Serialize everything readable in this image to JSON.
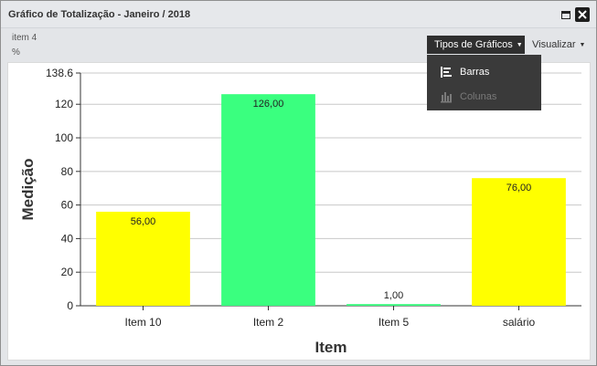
{
  "window": {
    "title": "Gráfico de Totalização - Janeiro / 2018"
  },
  "toolbar": {
    "left_line1": "item 4",
    "left_line2": "%",
    "chart_types_label": "Tipos de Gráficos",
    "view_label": "Visualizar"
  },
  "dropdown": {
    "items": [
      {
        "label": "Barras",
        "icon": "bars-icon",
        "enabled": true
      },
      {
        "label": "Colunas",
        "icon": "columns-icon",
        "enabled": false
      }
    ]
  },
  "colors": {
    "yellow": "#ffff00",
    "green": "#3aff7f",
    "grid": "#c8c8c8"
  },
  "chart_data": {
    "type": "bar",
    "categories": [
      "Item 10",
      "Item 2",
      "Item 5",
      "salário"
    ],
    "values": [
      56,
      126,
      1,
      76
    ],
    "data_labels": [
      "56,00",
      "126,00",
      "1,00",
      "76,00"
    ],
    "bar_colors": [
      "#ffff00",
      "#3aff7f",
      "#3aff7f",
      "#ffff00"
    ],
    "xlabel": "Item",
    "ylabel": "Medição",
    "ylim": [
      0,
      138.6
    ],
    "yticks": [
      0,
      20,
      40,
      60,
      80,
      100,
      120,
      138.6
    ],
    "ytick_labels": [
      "0",
      "20",
      "40",
      "60",
      "80",
      "100",
      "120",
      "138.6"
    ],
    "grid": true
  }
}
